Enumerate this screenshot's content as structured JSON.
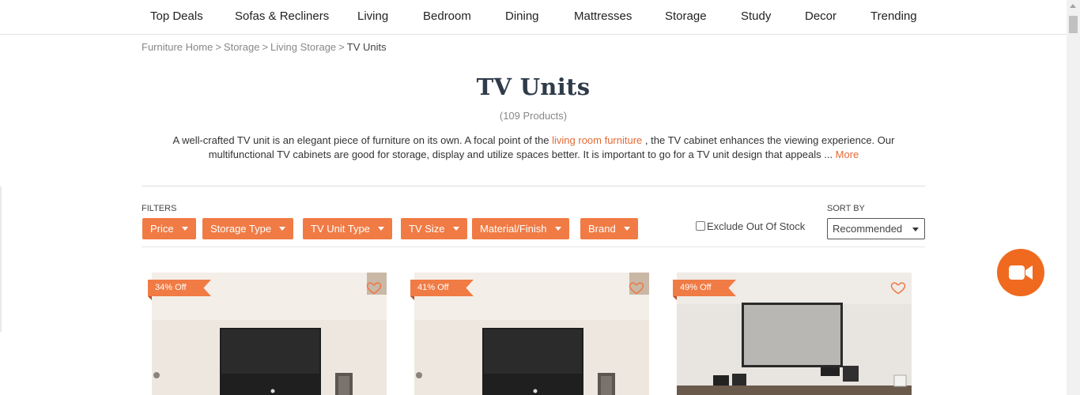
{
  "topnav": {
    "items": [
      "Top Deals",
      "Sofas & Recliners",
      "Living",
      "Bedroom",
      "Dining",
      "Mattresses",
      "Storage",
      "Study",
      "Decor",
      "Trending"
    ]
  },
  "breadcrumb": {
    "items": [
      "Furniture Home",
      "Storage",
      "Living Storage",
      "TV Units"
    ],
    "separator": ">"
  },
  "page": {
    "title": "TV Units",
    "count": "(109 Products)"
  },
  "description": {
    "before_link": "A well-crafted TV unit is an elegant piece of furniture on its own. A focal point of the ",
    "link": "living room furniture",
    "after_link": " , the TV cabinet enhances the viewing experience. Our multifunctional TV cabinets are good for storage, display and utilize spaces better. It is important to go for a TV unit design that appeals ... ",
    "more": "More"
  },
  "filters": {
    "label": "FILTERS",
    "buttons": [
      "Price",
      "Storage Type",
      "TV Unit Type",
      "TV Size",
      "Material/Finish",
      "Brand"
    ]
  },
  "exclude_out_of_stock": {
    "label": "Exclude Out Of Stock",
    "checked": false
  },
  "sort": {
    "label": "SORT BY",
    "selected": "Recommended"
  },
  "products": [
    {
      "discount": "34% Off"
    },
    {
      "discount": "41% Off"
    },
    {
      "discount": "49% Off"
    }
  ],
  "colors": {
    "accent": "#f07b45",
    "video_button": "#ef6a1f",
    "title": "#2f3b4a"
  },
  "icons": {
    "wishlist": "heart-outline-icon",
    "video": "video-camera-icon"
  }
}
